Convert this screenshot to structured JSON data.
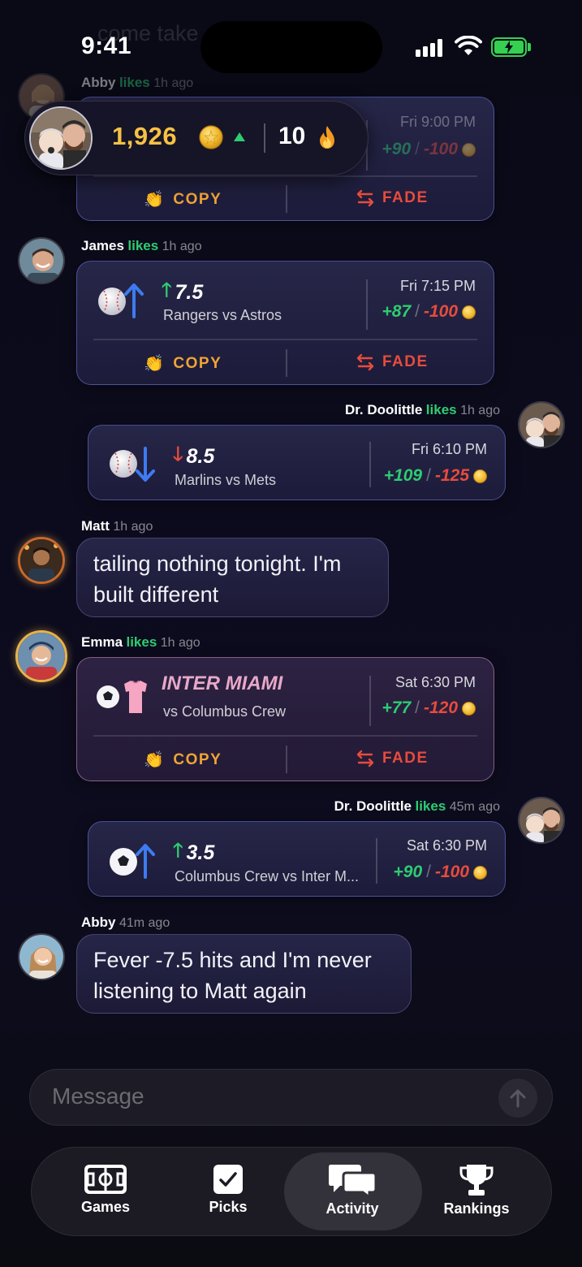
{
  "status_bar": {
    "time": "9:41"
  },
  "ghost_text": "come take",
  "header": {
    "coins": "1,926",
    "streak": "10"
  },
  "feed": [
    {
      "user": "Abby",
      "verb": "likes",
      "ago": "1h ago",
      "time": "Fri 9:00 PM",
      "odds_pos": "+90",
      "odds_neg": "-100",
      "copy": "COPY",
      "fade": "FADE"
    },
    {
      "user": "James",
      "verb": "likes",
      "ago": "1h ago",
      "line": "7.5",
      "matchup": "Rangers vs Astros",
      "time": "Fri 7:15 PM",
      "odds_pos": "+87",
      "odds_neg": "-100",
      "copy": "COPY",
      "fade": "FADE"
    },
    {
      "user": "Dr. Doolittle",
      "verb": "likes",
      "ago": "1h ago",
      "line": "8.5",
      "matchup": "Marlins vs Mets",
      "time": "Fri 6:10 PM",
      "odds_pos": "+109",
      "odds_neg": "-125"
    },
    {
      "user": "Matt",
      "ago": "1h ago",
      "text": "tailing nothing tonight. I'm built different"
    },
    {
      "user": "Emma",
      "verb": "likes",
      "ago": "1h ago",
      "line": "INTER MIAMI",
      "matchup": "vs Columbus Crew",
      "time": "Sat 6:30 PM",
      "odds_pos": "+77",
      "odds_neg": "-120",
      "copy": "COPY",
      "fade": "FADE"
    },
    {
      "user": "Dr. Doolittle",
      "verb": "likes",
      "ago": "45m ago",
      "line": "3.5",
      "matchup": "Columbus Crew vs Inter M...",
      "time": "Sat 6:30 PM",
      "odds_pos": "+90",
      "odds_neg": "-100"
    },
    {
      "user": "Abby",
      "ago": "41m ago",
      "text": "Fever -7.5 hits and I'm never listening to Matt again"
    }
  ],
  "composer": {
    "placeholder": "Message"
  },
  "tabs": [
    {
      "label": "Games",
      "icon": "field-icon"
    },
    {
      "label": "Picks",
      "icon": "checkbox-icon"
    },
    {
      "label": "Activity",
      "icon": "chat-bubbles-icon",
      "active": true
    },
    {
      "label": "Rankings",
      "icon": "trophy-icon"
    }
  ],
  "colors": {
    "accent_green": "#2ecc71",
    "accent_red": "#e74c3c",
    "coin_gold": "#f7c144",
    "copy_orange": "#f0a436"
  }
}
